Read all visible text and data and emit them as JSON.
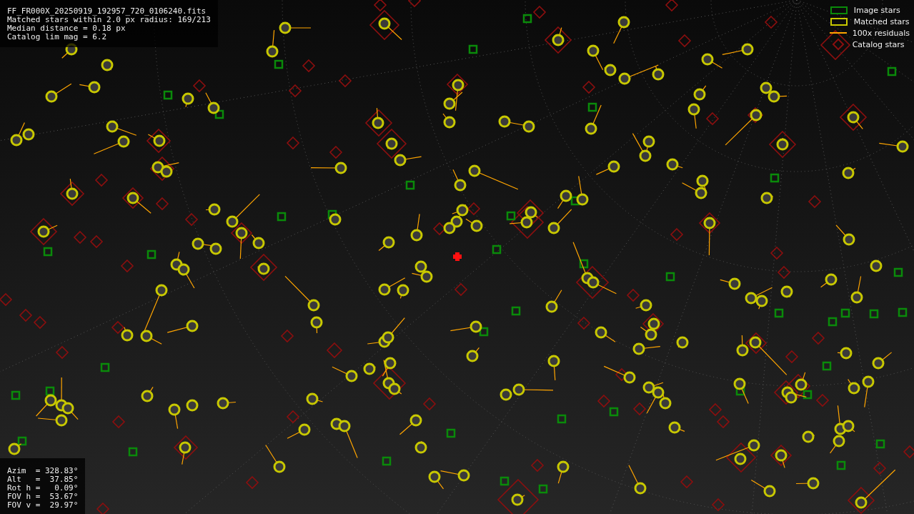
{
  "file_info": {
    "lines": [
      "FF_FR000X_20250919_192957_720_0106240.fits",
      "Matched stars within 2.0 px radius: 169/213",
      "Median distance = 0.18 px",
      "Catalog lim mag = 6.2"
    ]
  },
  "legend": [
    {
      "kind": "box",
      "color": "#0a8a0a",
      "label": "Image stars"
    },
    {
      "kind": "box",
      "color": "#c8c800",
      "label": "Matched stars"
    },
    {
      "kind": "line",
      "color": "#ffa500",
      "label": "100x residuals"
    },
    {
      "kind": "diamond",
      "color": "#8b0f0f",
      "label": "Catalog stars"
    }
  ],
  "pointing": {
    "lines": [
      "Azim  = 328.83°",
      "Alt   =  37.85°",
      "Rot h =   0.09°",
      "FOV h =  53.67°",
      "FOV v =  29.97°"
    ]
  }
}
